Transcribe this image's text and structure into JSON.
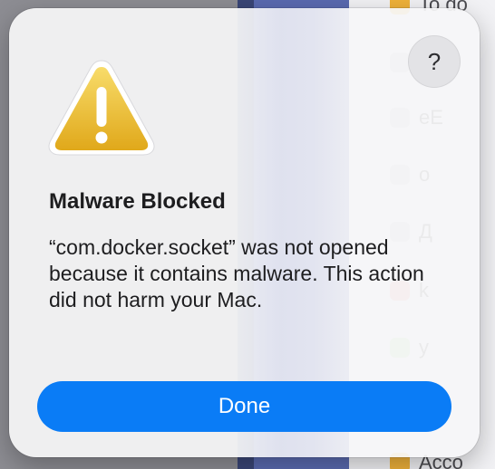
{
  "dialog": {
    "help_label": "?",
    "title": "Malware Blocked",
    "message": "“com.docker.socket” was not opened because it contains malware. This action did not harm your Mac.",
    "done_label": "Done"
  },
  "background": {
    "list_items": [
      {
        "label": "To do"
      },
      {
        "label": "m"
      },
      {
        "label": "eE"
      },
      {
        "label": "o"
      },
      {
        "label": "Д"
      },
      {
        "label": "k"
      },
      {
        "label": "y"
      },
      {
        "label": "B"
      },
      {
        "label": "Acco"
      }
    ]
  },
  "colors": {
    "accent": "#0a7cf6",
    "warning_yellow": "#f2c12e"
  }
}
